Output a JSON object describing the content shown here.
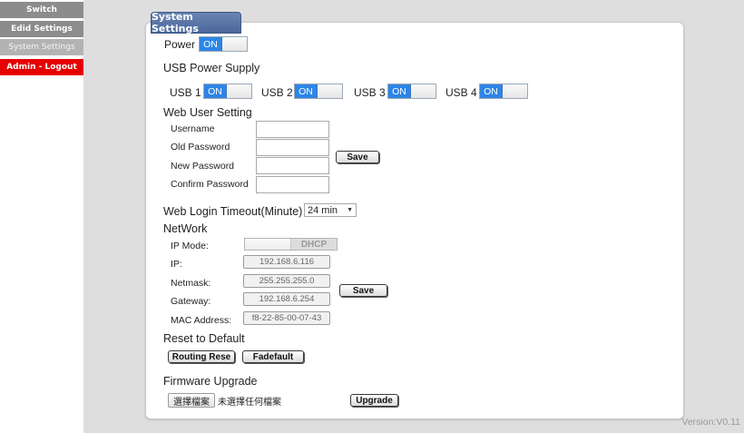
{
  "sidebar": {
    "items": [
      {
        "label": "Switch"
      },
      {
        "label": "Edid Settings"
      },
      {
        "label": "System Settings"
      },
      {
        "label": "Admin - Logout"
      }
    ]
  },
  "panel": {
    "title": "System Settings",
    "power": {
      "label": "Power",
      "state": "ON"
    },
    "usb": {
      "section_label": "USB Power Supply",
      "ports": [
        {
          "label": "USB 1",
          "state": "ON"
        },
        {
          "label": "USB 2",
          "state": "ON"
        },
        {
          "label": "USB 3",
          "state": "ON"
        },
        {
          "label": "USB 4",
          "state": "ON"
        }
      ]
    },
    "web_user": {
      "section_label": "Web User Setting",
      "username_label": "Username",
      "old_password_label": "Old Password",
      "new_password_label": "New Password",
      "confirm_password_label": "Confirm Password",
      "save_label": "Save"
    },
    "timeout": {
      "label": "Web Login Timeout(Minute)",
      "value": "24 min"
    },
    "network": {
      "section_label": "NetWork",
      "ip_mode_label": "IP Mode:",
      "ip_mode_value": "DHCP",
      "ip_label": "IP:",
      "ip_value": "192.168.6.116",
      "netmask_label": "Netmask:",
      "netmask_value": "255.255.255.0",
      "gateway_label": "Gateway:",
      "gateway_value": "192.168.6.254",
      "mac_label": "MAC Address:",
      "mac_value": "f8-22-85-00-07-43",
      "save_label": "Save"
    },
    "reset": {
      "section_label": "Reset to Default",
      "routing_reset_label": "Routing Rese",
      "factory_default_label": "Fadefault"
    },
    "firmware": {
      "section_label": "Firmware Upgrade",
      "choose_file_label": "選擇檔案",
      "no_file_label": "未選擇任何檔案",
      "upgrade_label": "Upgrade"
    }
  },
  "footer": {
    "version": "Version:V0.11"
  },
  "colors": {
    "nav_gray": "#8c8c8c",
    "nav_active": "#b3b3b3",
    "logout_red": "#e60000",
    "toggle_on": "#2e85e6",
    "title_blue": "#5873a4"
  }
}
